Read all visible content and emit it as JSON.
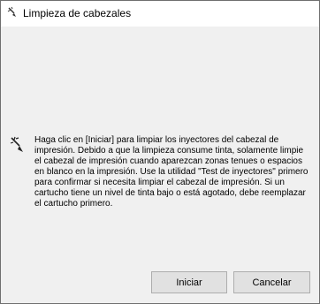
{
  "window": {
    "title": "Limpieza de cabezales",
    "title_icon": "printer-head-icon"
  },
  "message": {
    "icon": "nozzle-cleaning-icon",
    "text": "Haga clic en [Iniciar] para limpiar los inyectores del cabezal de impresión. Debido a que la limpieza consume tinta, solamente limpie el cabezal de impresión cuando aparezcan zonas tenues o espacios en blanco en la impresión. Use la utilidad \"Test de inyectores\" primero para confirmar si necesita limpiar el cabezal de impresión. Si un cartucho tiene un nivel de tinta bajo o está agotado, debe reemplazar el cartucho primero."
  },
  "buttons": {
    "start_label": "Iniciar",
    "cancel_label": "Cancelar"
  },
  "colors": {
    "dialog_background": "#f0f0f0",
    "titlebar_background": "#ffffff",
    "button_background": "#e1e1e1",
    "button_border": "#adadad"
  }
}
